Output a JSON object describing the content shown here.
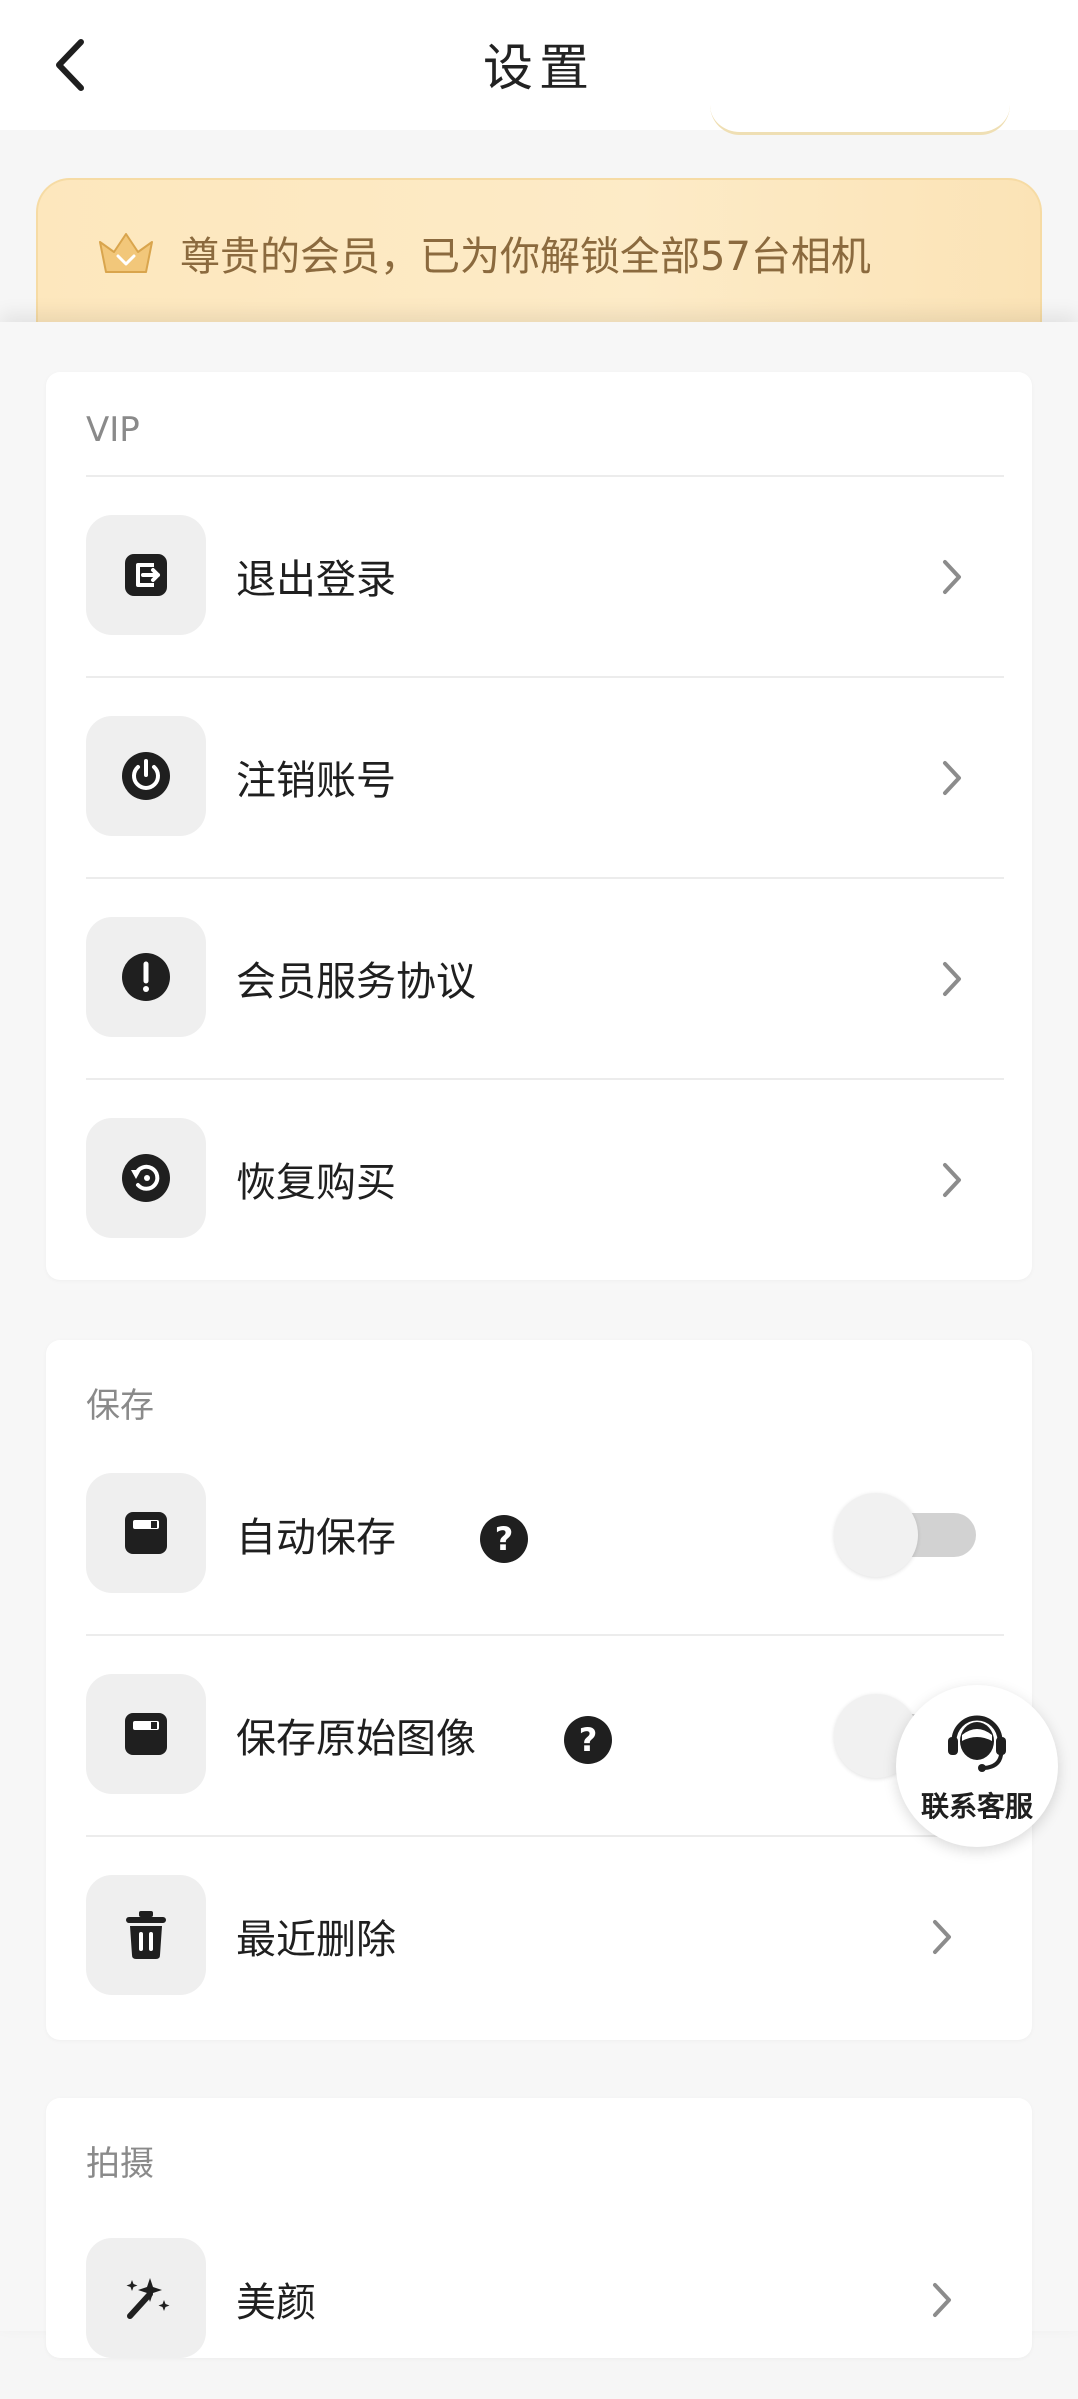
{
  "header": {
    "title": "设置",
    "back_icon": "chevron-left-icon"
  },
  "vip_banner": {
    "text": "尊贵的会员，已为你解锁全部57台相机",
    "icon": "crown-icon",
    "text_color": "#8b6a3e",
    "bg_color": "#fde7bd"
  },
  "sections": {
    "vip": {
      "title": "VIP",
      "items": [
        {
          "label": "退出登录",
          "icon": "logout-icon"
        },
        {
          "label": "注销账号",
          "icon": "power-icon"
        },
        {
          "label": "会员服务协议",
          "icon": "alert-icon"
        },
        {
          "label": "恢复购买",
          "icon": "restore-icon"
        }
      ]
    },
    "save": {
      "title": "保存",
      "items": [
        {
          "label": "自动保存",
          "icon": "save-icon",
          "help": "?",
          "toggle_on": false
        },
        {
          "label": "保存原始图像",
          "icon": "save-icon",
          "help": "?",
          "toggle_on": false
        },
        {
          "label": "最近删除",
          "icon": "trash-icon"
        }
      ]
    },
    "shoot": {
      "title": "拍摄",
      "items": [
        {
          "label": "美颜",
          "icon": "magic-wand-icon"
        }
      ]
    }
  },
  "support": {
    "label": "联系客服",
    "icon": "headset-icon"
  }
}
